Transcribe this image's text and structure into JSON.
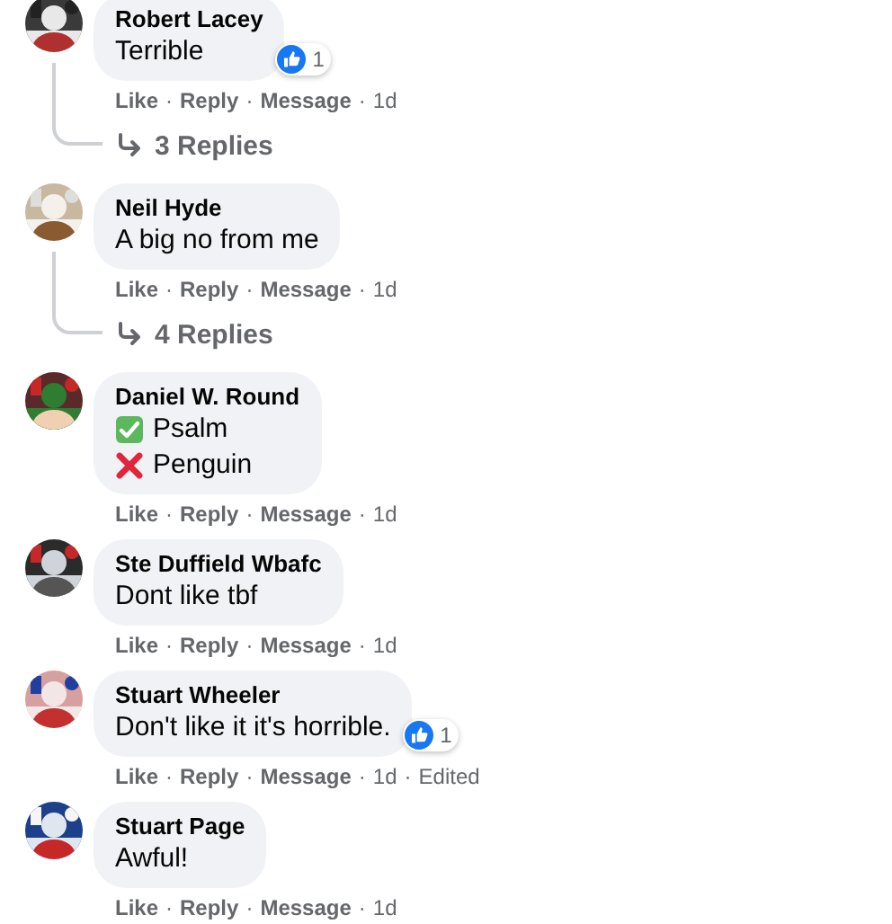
{
  "comments": [
    {
      "author": "Robert Lacey",
      "lines": [
        {
          "text": "Terrible"
        }
      ],
      "reactions": {
        "kind": "like",
        "count": "1"
      },
      "actions": [
        "Like",
        "Reply",
        "Message"
      ],
      "time": "1d",
      "replies": "3 Replies"
    },
    {
      "author": "Neil Hyde",
      "lines": [
        {
          "text": "A big no from me"
        }
      ],
      "actions": [
        "Like",
        "Reply",
        "Message"
      ],
      "time": "1d",
      "replies": "4 Replies"
    },
    {
      "author": "Daniel W. Round",
      "lines": [
        {
          "kind": "check",
          "text": "Psalm"
        },
        {
          "kind": "cross",
          "text": "Penguin"
        }
      ],
      "actions": [
        "Like",
        "Reply",
        "Message"
      ],
      "time": "1d"
    },
    {
      "author": "Ste Duffield Wbafc",
      "lines": [
        {
          "text": "Dont like tbf"
        }
      ],
      "actions": [
        "Like",
        "Reply",
        "Message"
      ],
      "time": "1d"
    },
    {
      "author": "Stuart Wheeler",
      "lines": [
        {
          "text": "Don't like it it's horrible."
        }
      ],
      "reactions": {
        "kind": "like",
        "count": "1"
      },
      "actions": [
        "Like",
        "Reply",
        "Message"
      ],
      "time": "1d",
      "edited": "Edited"
    },
    {
      "author": "Stuart Page",
      "lines": [
        {
          "text": "Awful!"
        }
      ],
      "actions": [
        "Like",
        "Reply",
        "Message"
      ],
      "time": "1d"
    }
  ],
  "separator": "·"
}
